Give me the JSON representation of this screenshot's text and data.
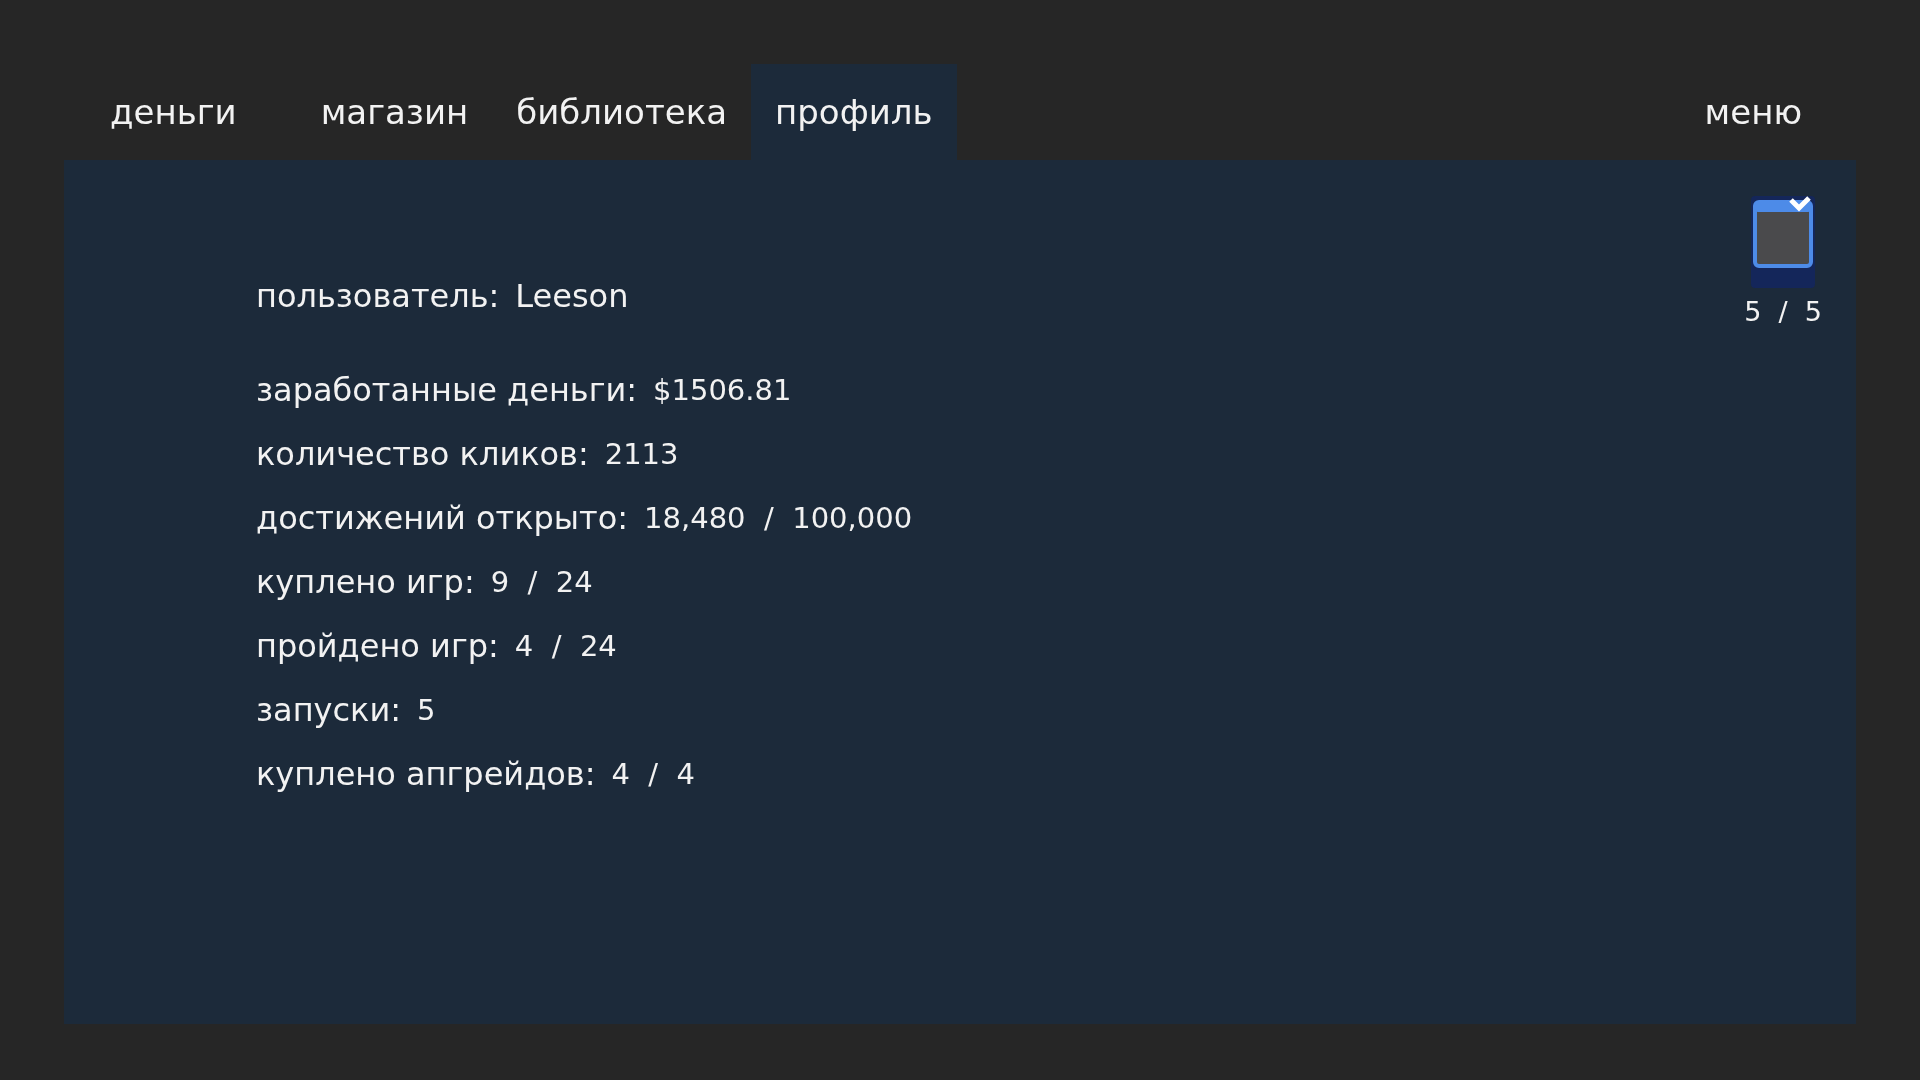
{
  "tabs": [
    {
      "label": "деньги",
      "selected": false
    },
    {
      "label": "магазин",
      "selected": false
    },
    {
      "label": "библиотека",
      "selected": false
    },
    {
      "label": "профиль",
      "selected": true
    }
  ],
  "menu": {
    "label": "меню"
  },
  "profile": {
    "user_label": "пользователь:",
    "user_name": "Leeson",
    "stats": [
      {
        "label": "заработанные деньги:",
        "value": "$1506.81"
      },
      {
        "label": "количество кликов:",
        "value": "2113"
      },
      {
        "label": "достижений открыто:",
        "value": "18,480  /  100,000"
      },
      {
        "label": "куплено игр:",
        "value": "9  /  24"
      },
      {
        "label": "пройдено игр:",
        "value": "4  /  24"
      },
      {
        "label": "запуски:",
        "value": "5"
      },
      {
        "label": "куплено апгрейдов:",
        "value": "4  /  4"
      }
    ]
  },
  "badge": {
    "count": "5  /  5"
  }
}
